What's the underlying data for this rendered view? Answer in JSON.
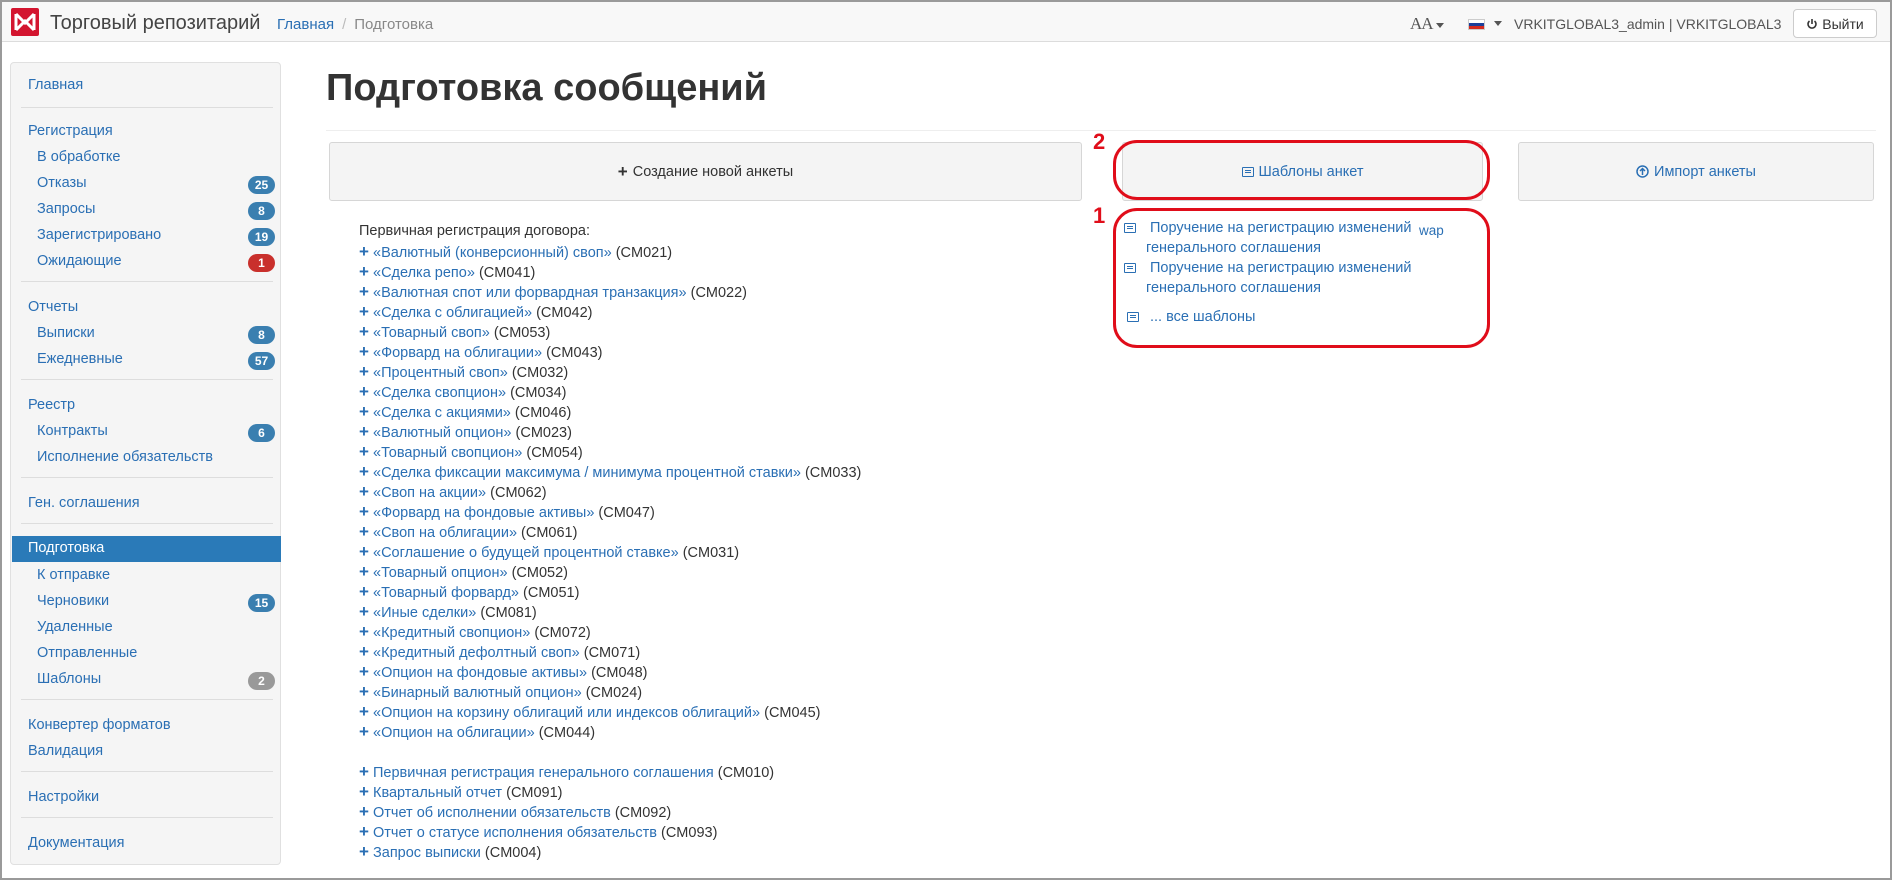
{
  "header": {
    "brand": "Торговый репозитарий",
    "breadcrumb_home": "Главная",
    "breadcrumb_separator": "/",
    "breadcrumb_current": "Подготовка",
    "font_menu": "AA",
    "user": "VRKITGLOBAL3_admin | VRKITGLOBAL3",
    "logout_label": "Выйти"
  },
  "sidebar": {
    "home": "Главная",
    "registration": "Регистрация",
    "in_processing": "В обработке",
    "refusals": "Отказы",
    "refusals_count": "25",
    "requests": "Запросы",
    "requests_count": "8",
    "registered": "Зарегистрировано",
    "registered_count": "19",
    "pending": "Ожидающие",
    "pending_count": "1",
    "reports": "Отчеты",
    "statements": "Выписки",
    "statements_count": "8",
    "daily": "Ежедневные",
    "daily_count": "57",
    "registry": "Реестр",
    "contracts": "Контракты",
    "contracts_count": "6",
    "obligations": "Исполнение обязательств",
    "gen_agreements": "Ген. соглашения",
    "preparation": "Подготовка",
    "to_send": "К отправке",
    "drafts": "Черновики",
    "drafts_count": "15",
    "deleted": "Удаленные",
    "sent": "Отправленные",
    "templates": "Шаблоны",
    "templates_count": "2",
    "converter": "Конвертер форматов",
    "validation": "Валидация",
    "settings": "Настройки",
    "docs": "Документация"
  },
  "main": {
    "title": "Подготовка сообщений",
    "btn_new": "Создание новой анкеты",
    "btn_templates": "Шаблоны анкет",
    "btn_import": "Импорт анкеты",
    "reg_heading": "Первичная регистрация договора:",
    "contracts": [
      {
        "name": "«Валютный (конверсионный) своп»",
        "code": "(CM021)"
      },
      {
        "name": "«Сделка репо»",
        "code": "(CM041)"
      },
      {
        "name": "«Валютная спот или форвардная транзакция»",
        "code": "(CM022)"
      },
      {
        "name": "«Сделка с облигацией»",
        "code": "(CM042)"
      },
      {
        "name": "«Товарный своп»",
        "code": "(CM053)"
      },
      {
        "name": "«Форвард на облигации»",
        "code": "(CM043)"
      },
      {
        "name": "«Процентный своп»",
        "code": "(CM032)"
      },
      {
        "name": "«Сделка свопцион»",
        "code": "(CM034)"
      },
      {
        "name": "«Сделка с акциями»",
        "code": "(CM046)"
      },
      {
        "name": "«Валютный опцион»",
        "code": "(CM023)"
      },
      {
        "name": "«Товарный свопцион»",
        "code": "(CM054)"
      },
      {
        "name": "«Сделка фиксации максимума / минимума процентной ставки»",
        "code": "(CM033)"
      },
      {
        "name": "«Своп на акции»",
        "code": "(CM062)"
      },
      {
        "name": "«Форвард на фондовые активы»",
        "code": "(CM047)"
      },
      {
        "name": "«Своп на облигации»",
        "code": "(CM061)"
      },
      {
        "name": "«Соглашение о будущей процентной ставке»",
        "code": "(CM031)"
      },
      {
        "name": "«Товарный опцион»",
        "code": "(CM052)"
      },
      {
        "name": "«Товарный форвард»",
        "code": "(CM051)"
      },
      {
        "name": "«Иные сделки»",
        "code": "(CM081)"
      },
      {
        "name": "«Кредитный свопцион»",
        "code": "(CM072)"
      },
      {
        "name": "«Кредитный дефолтный своп»",
        "code": "(CM071)"
      },
      {
        "name": "«Опцион на фондовые активы»",
        "code": "(CM048)"
      },
      {
        "name": "«Бинарный валютный опцион»",
        "code": "(CM024)"
      },
      {
        "name": "«Опцион на корзину облигаций или индексов облигаций»",
        "code": "(CM045)"
      },
      {
        "name": "«Опцион на облигации»",
        "code": "(CM044)"
      }
    ],
    "other_forms": [
      {
        "name": "Первичная регистрация генерального соглашения",
        "code": "(CM010)"
      },
      {
        "name": "Квартальный отчет",
        "code": "(CM091)"
      },
      {
        "name": "Отчет об исполнении обязательств",
        "code": "(CM092)"
      },
      {
        "name": "Отчет о статусе исполнения обязательств",
        "code": "(CM093)"
      },
      {
        "name": "Запрос выписки",
        "code": "(CM004)"
      }
    ],
    "template_1_line1": "Поручение на регистрацию изменений",
    "template_1_line2": "генерального соглашения",
    "template_1_tag": "wap",
    "template_2_line1": "Поручение на регистрацию изменений",
    "template_2_line2": "генерального соглашения",
    "all_templates": "... все шаблоны"
  },
  "annotations": {
    "label_1": "1",
    "label_2": "2"
  },
  "colors": {
    "accent": "#2a6fb4",
    "active": "#2a7ab8",
    "highlight": "#e00d1a",
    "logo": "#d3152f"
  }
}
